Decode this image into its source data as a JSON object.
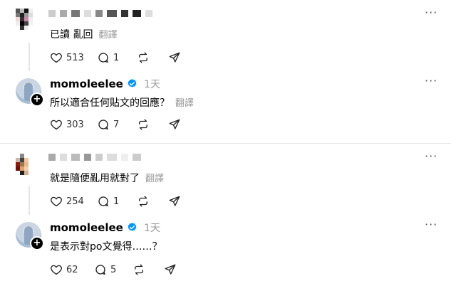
{
  "threads": [
    {
      "reply": {
        "text": "已讀 亂回",
        "translate": "翻譯",
        "stats": {
          "likes": "513",
          "comments": "1"
        }
      },
      "author_reply": {
        "username": "momoleelee",
        "time": "1天",
        "text": "所以適合任何貼文的回應？",
        "translate": "翻譯",
        "stats": {
          "likes": "303",
          "comments": "7"
        }
      }
    },
    {
      "reply": {
        "text": "就是隨便亂用就對了",
        "translate": "翻譯",
        "stats": {
          "likes": "254",
          "comments": "1"
        }
      },
      "author_reply": {
        "username": "momoleelee",
        "time": "1天",
        "text": "是表示對po文覺得……？",
        "translate": "翻譯",
        "stats": {
          "likes": "62",
          "comments": "5"
        }
      }
    }
  ],
  "colors": {
    "verified": "#0095f6",
    "muted": "#999999",
    "divider": "#e5e5e5"
  }
}
